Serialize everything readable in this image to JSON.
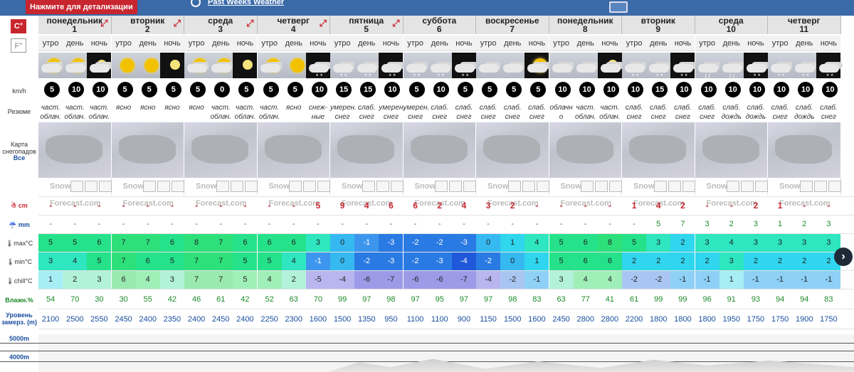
{
  "topbar": {
    "detail_label": "Нажмите для детализации",
    "past_weeks": "Past Weeks Weather"
  },
  "units": {
    "c": "C°",
    "f": "F°"
  },
  "row_labels": {
    "wind": "km/h",
    "summary": "Резюме",
    "map_title": "Карта снегопадов",
    "map_all": "Все",
    "snow": "☃ cm",
    "rain": "☔ mm",
    "max": "🌡max°C",
    "min": "🌡min°C",
    "chill": "🌡chill°C",
    "humidity": "Влажн.%",
    "freezing": "Уровень замерз. (m)",
    "level_5000": "5000m",
    "level_4000": "4000m"
  },
  "brand": "Snow-Forecast.com",
  "days": [
    {
      "name": "понедельник",
      "num": "1",
      "expand": true
    },
    {
      "name": "вторник",
      "num": "2",
      "expand": true
    },
    {
      "name": "среда",
      "num": "3",
      "expand": true
    },
    {
      "name": "четверг",
      "num": "4",
      "expand": true
    },
    {
      "name": "пятница",
      "num": "5",
      "expand": true
    },
    {
      "name": "суббота",
      "num": "6",
      "expand": false
    },
    {
      "name": "воскресенье",
      "num": "7",
      "expand": false
    },
    {
      "name": "понедельник",
      "num": "8",
      "expand": false
    },
    {
      "name": "вторник",
      "num": "9",
      "expand": false
    },
    {
      "name": "среда",
      "num": "10",
      "expand": false
    },
    {
      "name": "четверг",
      "num": "11",
      "expand": false
    }
  ],
  "tod": [
    "утро",
    "день",
    "ночь"
  ],
  "icons": [
    "sun-cloud",
    "sun-cloud",
    "moon-cloud",
    "sun",
    "sun",
    "moon",
    "sun-cloud",
    "sun-cloud",
    "moon",
    "sun-cloud",
    "sun",
    "snow",
    "snow",
    "snow",
    "snow",
    "snow",
    "snow",
    "snow",
    "cloud",
    "cloud",
    "sun-cloud",
    "cloud",
    "cloud",
    "moon-cloud",
    "snow",
    "snow",
    "snow",
    "rain",
    "rain",
    "snow",
    "snow",
    "snow",
    "snow"
  ],
  "wind": [
    "5",
    "10",
    "10",
    "5",
    "5",
    "5",
    "5",
    "0",
    "5",
    "5",
    "5",
    "10",
    "15",
    "15",
    "10",
    "5",
    "10",
    "5",
    "5",
    "5",
    "5",
    "10",
    "10",
    "10",
    "10",
    "15",
    "10",
    "10",
    "10",
    "10",
    "10",
    "10",
    "10"
  ],
  "summary": [
    "част. облач.",
    "част. облач.",
    "част. облач.",
    "ясно",
    "ясно",
    "ясно",
    "ясно",
    "част. облач.",
    "част. облач.",
    "част. облач.",
    "ясно",
    "снеж- ные",
    "умерен. снег",
    "слаб. снег",
    "умерен. снег",
    "умерен. снег",
    "слаб. снег",
    "слаб. снег",
    "слаб. снег",
    "слаб. снег",
    "слаб. снег",
    "облачн о",
    "част. облач.",
    "част. облач.",
    "слаб. снег",
    "слаб. снег",
    "слаб. снег",
    "слаб. снег",
    "слаб. дождь",
    "слаб. дождь",
    "слаб. снег",
    "слаб. дождь",
    "слаб. снег"
  ],
  "snow": [
    "-",
    "-",
    "-",
    "-",
    "-",
    "-",
    "-",
    "-",
    "-",
    "-",
    "-",
    "5",
    "9",
    "4",
    "6",
    "6",
    "2",
    "4",
    "3",
    "2",
    "-",
    "-",
    "-",
    "-",
    "1",
    "4",
    "2",
    "-",
    "-",
    "2",
    "1",
    "-",
    "-"
  ],
  "rain": [
    "-",
    "-",
    "-",
    "-",
    "-",
    "-",
    "-",
    "-",
    "-",
    "-",
    "-",
    "-",
    "-",
    "-",
    "-",
    "-",
    "-",
    "-",
    "-",
    "-",
    "-",
    "-",
    "-",
    "-",
    "-",
    "5",
    "7",
    "3",
    "2",
    "3",
    "1",
    "2",
    "3"
  ],
  "tmax": [
    "5",
    "5",
    "6",
    "7",
    "7",
    "6",
    "8",
    "7",
    "6",
    "6",
    "6",
    "3",
    "0",
    "-1",
    "-3",
    "-2",
    "-2",
    "-3",
    "0",
    "1",
    "4",
    "5",
    "6",
    "8",
    "5",
    "3",
    "2",
    "3",
    "4",
    "3",
    "3",
    "3",
    "3"
  ],
  "tmin": [
    "3",
    "4",
    "5",
    "7",
    "6",
    "5",
    "7",
    "7",
    "5",
    "5",
    "4",
    "-1",
    "0",
    "-2",
    "-3",
    "-2",
    "-3",
    "-4",
    "-2",
    "0",
    "1",
    "5",
    "6",
    "6",
    "2",
    "2",
    "2",
    "2",
    "3",
    "2",
    "2",
    "2",
    "2"
  ],
  "chill": [
    "1",
    "2",
    "3",
    "6",
    "4",
    "3",
    "7",
    "7",
    "5",
    "4",
    "2",
    "-5",
    "-4",
    "-6",
    "-7",
    "-6",
    "-6",
    "-7",
    "-4",
    "-2",
    "-1",
    "3",
    "4",
    "4",
    "-2",
    "-2",
    "-1",
    "-1",
    "1",
    "-1",
    "-1",
    "-1",
    "-1"
  ],
  "humidity": [
    "54",
    "70",
    "30",
    "30",
    "55",
    "42",
    "46",
    "61",
    "42",
    "52",
    "63",
    "70",
    "99",
    "97",
    "98",
    "97",
    "95",
    "97",
    "97",
    "98",
    "83",
    "63",
    "77",
    "41",
    "61",
    "99",
    "99",
    "96",
    "91",
    "93",
    "94",
    "94",
    "83"
  ],
  "freezing": [
    "2100",
    "2500",
    "2550",
    "2450",
    "2400",
    "2350",
    "2400",
    "2450",
    "2400",
    "2250",
    "2300",
    "1600",
    "1500",
    "1350",
    "950",
    "1100",
    "1100",
    "900",
    "1150",
    "1500",
    "1600",
    "2450",
    "2800",
    "2800",
    "2200",
    "1800",
    "1800",
    "1800",
    "1950",
    "1750",
    "1750",
    "1900",
    "1750"
  ],
  "colors": {
    "accent_red": "#c8262f",
    "header_blue": "#3a6aa8"
  }
}
